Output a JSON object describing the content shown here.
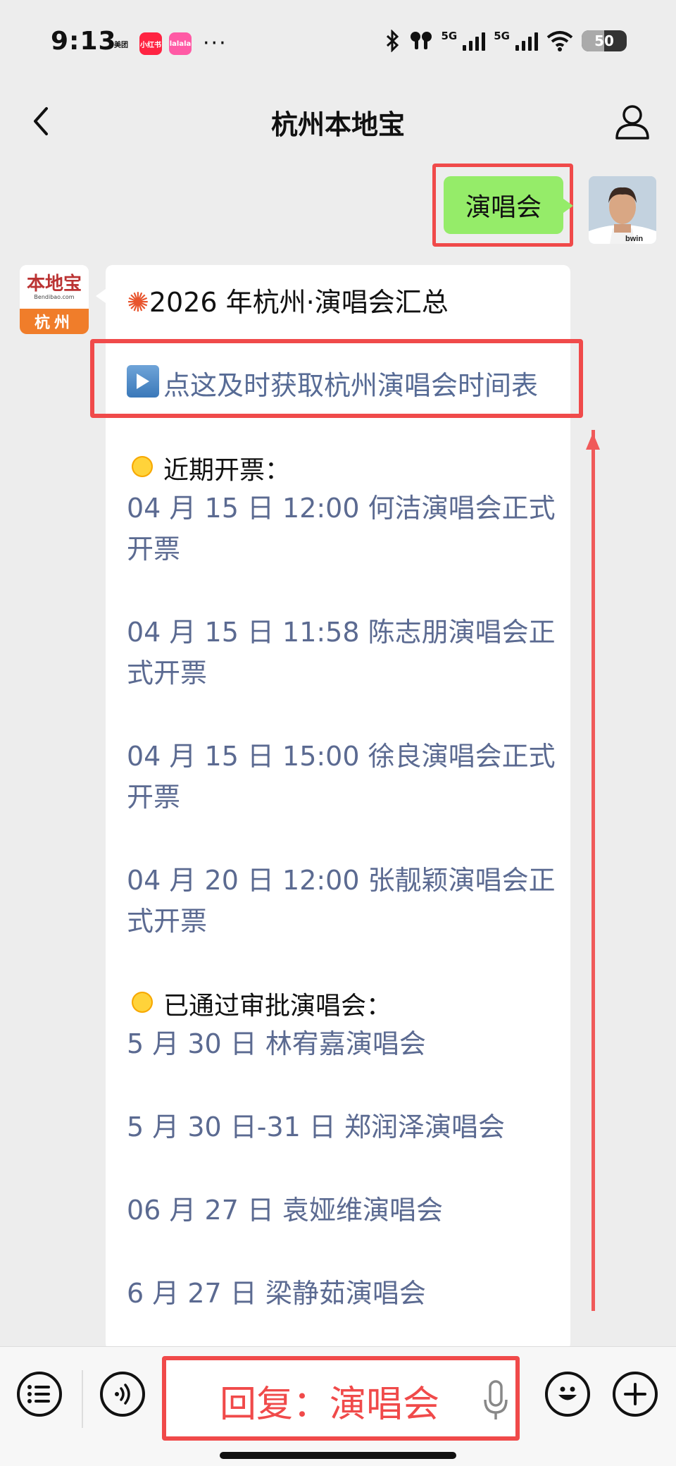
{
  "status_bar": {
    "time": "9:13",
    "apps": [
      {
        "label": "美团",
        "color": "#ffd100",
        "text_color": "#111"
      },
      {
        "label": "小红书",
        "color": "#ff2442",
        "text_color": "#fff"
      },
      {
        "label": "lalala",
        "color": "#ff5aa5",
        "text_color": "#fff"
      }
    ],
    "more": "···",
    "network_1": "5G",
    "network_2": "5G",
    "battery": "50"
  },
  "nav": {
    "title": "杭州本地宝"
  },
  "sent_message": {
    "text": "演唱会"
  },
  "logo": {
    "top_text": "本地宝",
    "domain_text": "Bendibao.com",
    "city_text": "杭州"
  },
  "message": {
    "heading": "2026 年杭州·演唱会汇总",
    "link_text": "点这及时获取杭州演唱会时间表",
    "section1_title": "近期开票：",
    "section1_items": [
      "04 月 15 日 12:00 何洁演唱会正式开票",
      "04 月 15 日 11:58 陈志朋演唱会正式开票",
      "04 月 15 日 15:00 徐良演唱会正式开票",
      "04 月 20 日 12:00 张靓颖演唱会正式开票"
    ],
    "section2_title": "已通过审批演唱会：",
    "section2_items": [
      "5 月 30 日 林宥嘉演唱会",
      "5 月 30 日-31 日 郑润泽演唱会",
      "06 月 27 日 袁娅维演唱会",
      "6 月 27 日 梁静茹演唱会"
    ]
  },
  "input_bar": {
    "reply_hint": "回复：演唱会"
  },
  "colors": {
    "highlight": "#f04a4a",
    "sent_bubble": "#95ec69",
    "link": "#576b95"
  }
}
